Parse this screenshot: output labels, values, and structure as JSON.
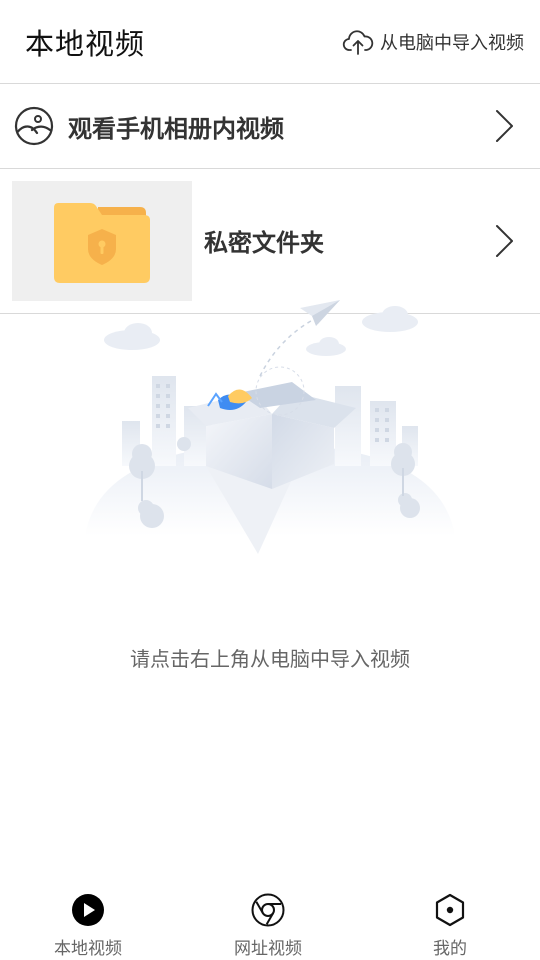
{
  "header": {
    "title": "本地视频",
    "import_label": "从电脑中导入视频",
    "import_icon": "cloud-upload-icon"
  },
  "rows": {
    "album": {
      "label": "观看手机相册内视频",
      "icon": "gallery-icon"
    },
    "private_folder": {
      "label": "私密文件夹",
      "icon": "lock-folder-icon"
    }
  },
  "empty_state": {
    "hint": "请点击右上角从电脑中导入视频",
    "illustration": "empty-box-illustration"
  },
  "bottom_nav": {
    "items": [
      {
        "label": "本地视频",
        "icon": "play-circle-icon",
        "active": true
      },
      {
        "label": "网址视频",
        "icon": "browser-icon",
        "active": false
      },
      {
        "label": "我的",
        "icon": "hexagon-icon",
        "active": false
      }
    ]
  },
  "colors": {
    "folder": "#ffcb62",
    "folder_tab": "#f6b14b",
    "divider": "#d9d9d9",
    "text_primary": "#333333",
    "text_secondary": "#666666"
  }
}
